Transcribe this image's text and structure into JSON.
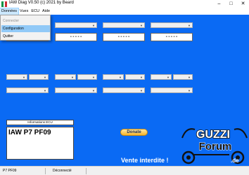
{
  "window": {
    "title": "IAW Diag V0.50  (c) 2021 by Beard",
    "minimize_glyph": "–",
    "maximize_glyph": "□",
    "close_glyph": "✕"
  },
  "menubar": {
    "items": [
      "Données",
      "Vues",
      "ECU",
      "Aide"
    ]
  },
  "menu_donnees": {
    "items": [
      "Connecter",
      "Configuration",
      "Quitter"
    ]
  },
  "value_boxes": [
    "-----",
    "-----",
    "-----",
    "-----"
  ],
  "combo_arrow": "▼",
  "info": {
    "label": "Informations ECU",
    "value": "IAW P7 PF09"
  },
  "donate_label": "Donate",
  "logo": {
    "line1": "GUZZI",
    "line2": "Forum",
    "suffix": ".de"
  },
  "watermark": "Vente interdite !",
  "statusbar": {
    "left": "P7 PF09",
    "right": "Déconnecté"
  },
  "colors": {
    "client_bg": "#0a6af4",
    "menu_highlight": "#91c9f7",
    "donate": "#f6b42a"
  }
}
